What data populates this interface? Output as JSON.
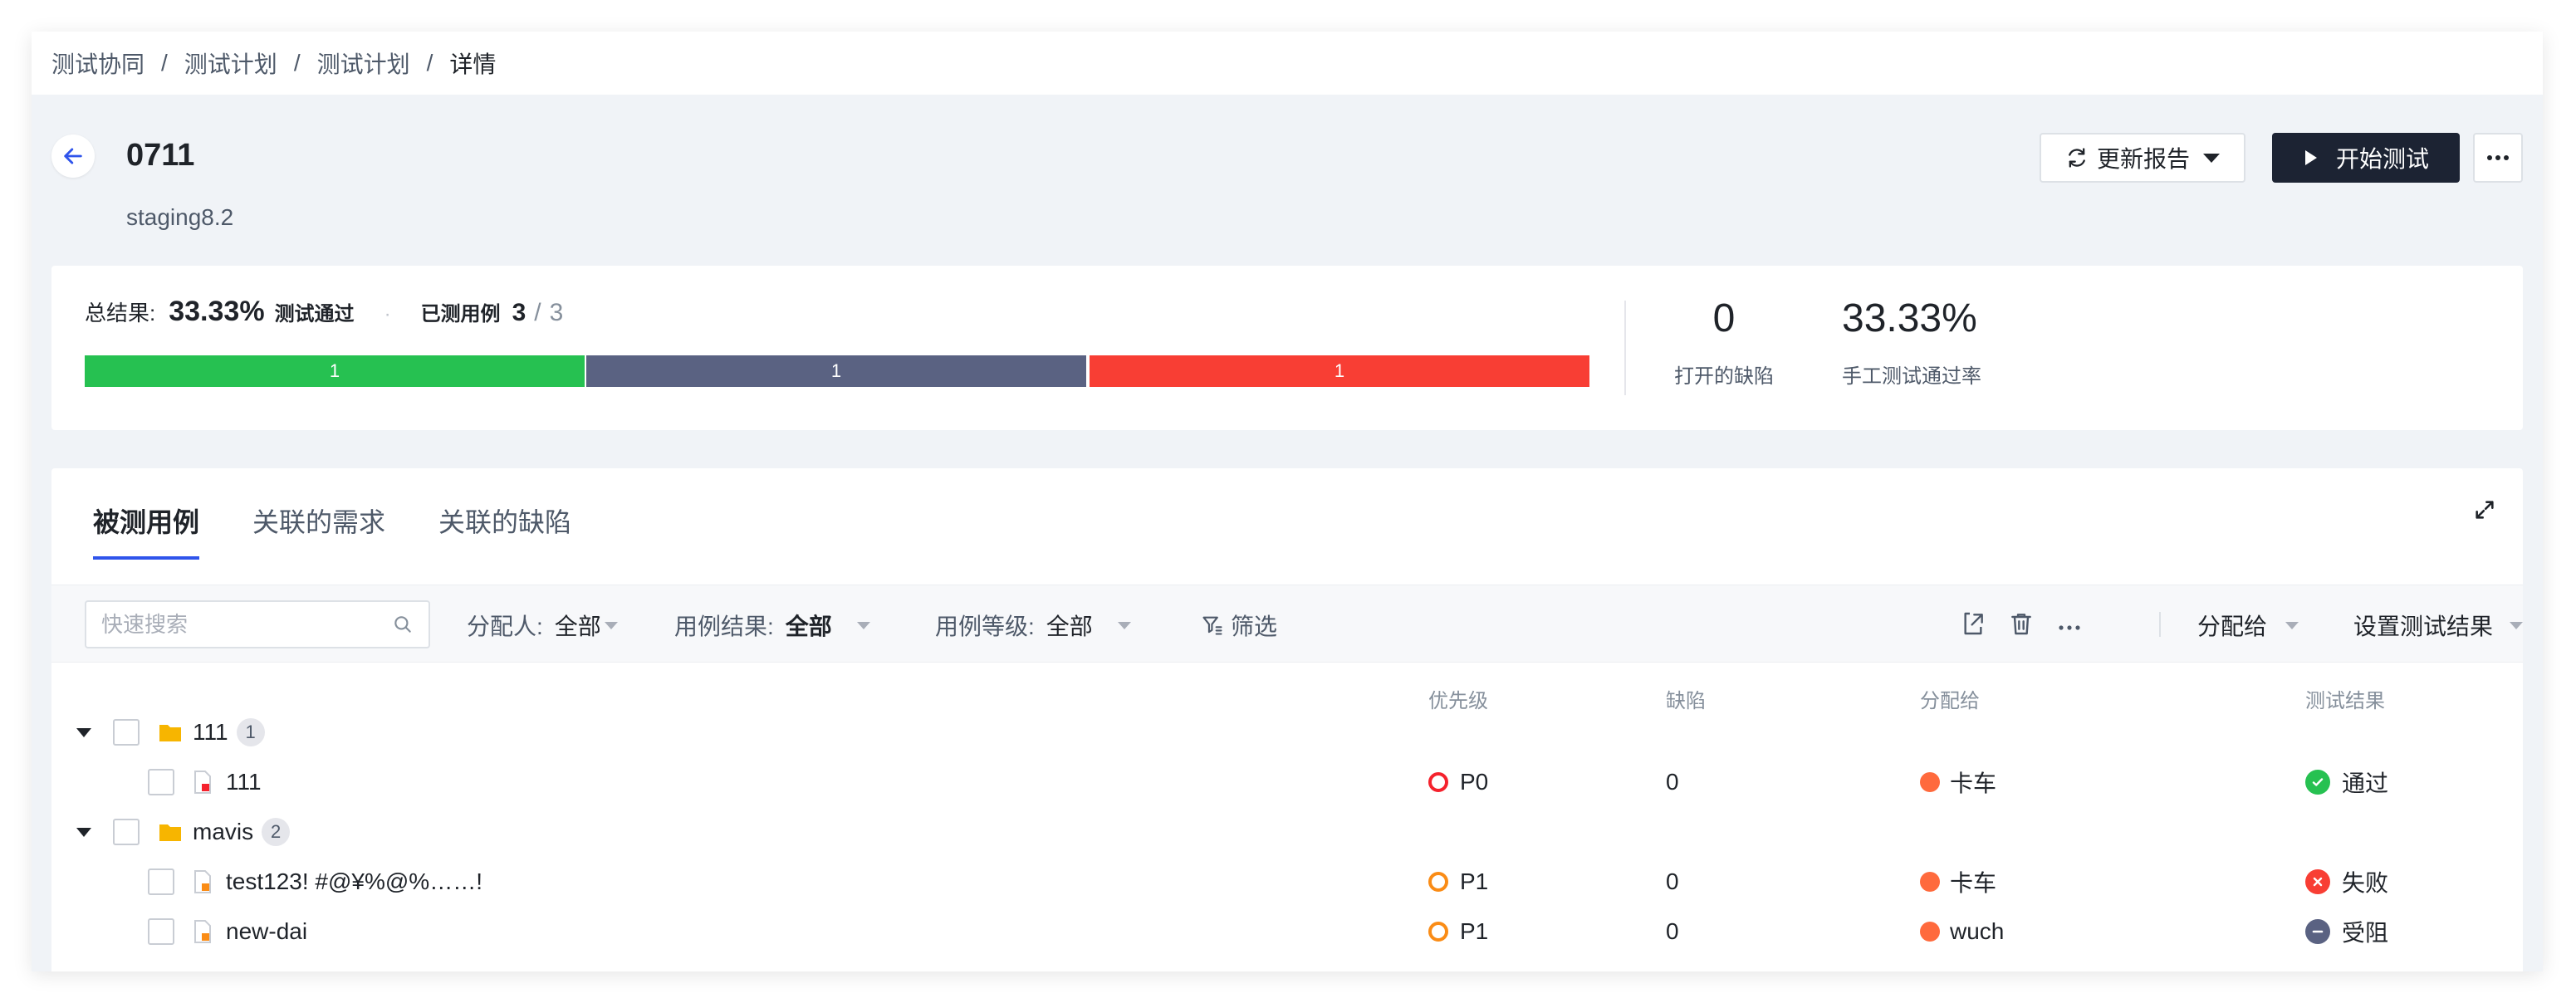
{
  "breadcrumb": [
    "测试协同",
    "测试计划",
    "测试计划",
    "详情"
  ],
  "breadcrumb_sep": "/",
  "plan": {
    "title": "0711",
    "subtitle": "staging8.2"
  },
  "actions": {
    "refresh_label": "更新报告",
    "start_label": "开始测试",
    "more_label": "..."
  },
  "summary": {
    "result_label": "总结果:",
    "pass_rate": "33.33%",
    "pass_text": "测试通过",
    "dot": "·",
    "tested_label": "已测用例",
    "tested": "3",
    "slash": "/",
    "total": "3",
    "progress": {
      "pass": 1,
      "blocked": 1,
      "failed": 1,
      "pass_label": "1",
      "blocked_label": "1",
      "failed_label": "1"
    },
    "open_defects": "0",
    "open_defects_label": "打开的缺陷",
    "manual_pass_rate": "33.33%",
    "manual_pass_rate_label": "手工测试通过率"
  },
  "tabs": [
    {
      "label": "被测用例",
      "active": true
    },
    {
      "label": "关联的需求",
      "active": false
    },
    {
      "label": "关联的缺陷",
      "active": false
    }
  ],
  "filters": {
    "search_placeholder": "快速搜索",
    "assignee_label": "分配人:",
    "assignee_value": "全部",
    "result_label": "用例结果:",
    "result_value": "全部",
    "level_label": "用例等级:",
    "level_value": "全部",
    "filter_label": "筛选",
    "assign_to_label": "分配给",
    "set_result_label": "设置测试结果"
  },
  "table": {
    "headers": {
      "priority": "优先级",
      "defects": "缺陷",
      "assignee": "分配给",
      "result": "测试结果"
    },
    "rows": [
      {
        "kind": "folder",
        "name": "111",
        "count": "1"
      },
      {
        "kind": "case",
        "name": "111",
        "priority": "P0",
        "defects": "0",
        "assignee": "卡车",
        "result": "通过",
        "result_type": "pass"
      },
      {
        "kind": "folder",
        "name": "mavis",
        "count": "2"
      },
      {
        "kind": "case",
        "name": "test123!  #@¥%@%……!",
        "priority": "P1",
        "defects": "0",
        "assignee": "卡车",
        "result": "失败",
        "result_type": "fail"
      },
      {
        "kind": "case",
        "name": "new-dai",
        "priority": "P1",
        "defects": "0",
        "assignee": "wuch",
        "result": "受阻",
        "result_type": "blocked"
      }
    ]
  },
  "colors": {
    "pass": "#26c151",
    "blocked": "#5a6282",
    "fail": "#f83e34",
    "primary_dark": "#1c2333",
    "accent": "#2f54eb",
    "folder": "#f7b500"
  },
  "icons": [
    "back-arrow-icon",
    "refresh-icon",
    "caret-down-icon",
    "play-icon",
    "more-icon",
    "expand-icon",
    "search-icon",
    "filter-icon",
    "move-icon",
    "trash-icon",
    "folder-icon",
    "case-file-icon",
    "check-icon",
    "close-icon",
    "minus-icon"
  ]
}
